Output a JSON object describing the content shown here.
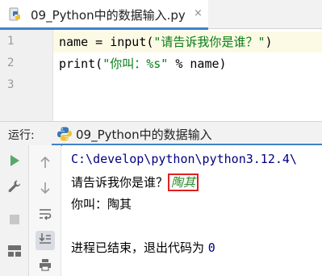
{
  "editor_tab": {
    "filename": "09_Python中的数据输入.py",
    "close_glyph": "×"
  },
  "editor": {
    "line_numbers": [
      "1",
      "2",
      "3"
    ],
    "line1": {
      "var": "name",
      "op": " = ",
      "func": "input",
      "open": "(",
      "str": "\"请告诉我你是谁？\"",
      "close": ")"
    },
    "line2": {
      "func": "print",
      "open": "(",
      "str": "\"你叫：%s\"",
      "rest": " % name)"
    }
  },
  "run_panel": {
    "label": "运行:",
    "tab_title": "09_Python中的数据输入",
    "console": {
      "path_line": "C:\\develop\\python\\python3.12.4\\",
      "prompt": "请告诉我你是谁？",
      "user_input": "陶其",
      "output_line": "你叫：陶其",
      "exit_text": "进程已结束，退出代码为 ",
      "exit_code": "0"
    }
  },
  "colors": {
    "accent": "#4083c9",
    "string": "#067d17",
    "run_green": "#59a869",
    "highlight_box": "#e02020"
  },
  "icons": {
    "toolbar_left": [
      "run-icon",
      "wrench-icon",
      "stop-icon",
      "layout-icon"
    ],
    "toolbar_right": [
      "arrow-up-icon",
      "arrow-down-icon",
      "soft-wrap-icon",
      "scroll-to-end-icon",
      "print-icon"
    ]
  }
}
